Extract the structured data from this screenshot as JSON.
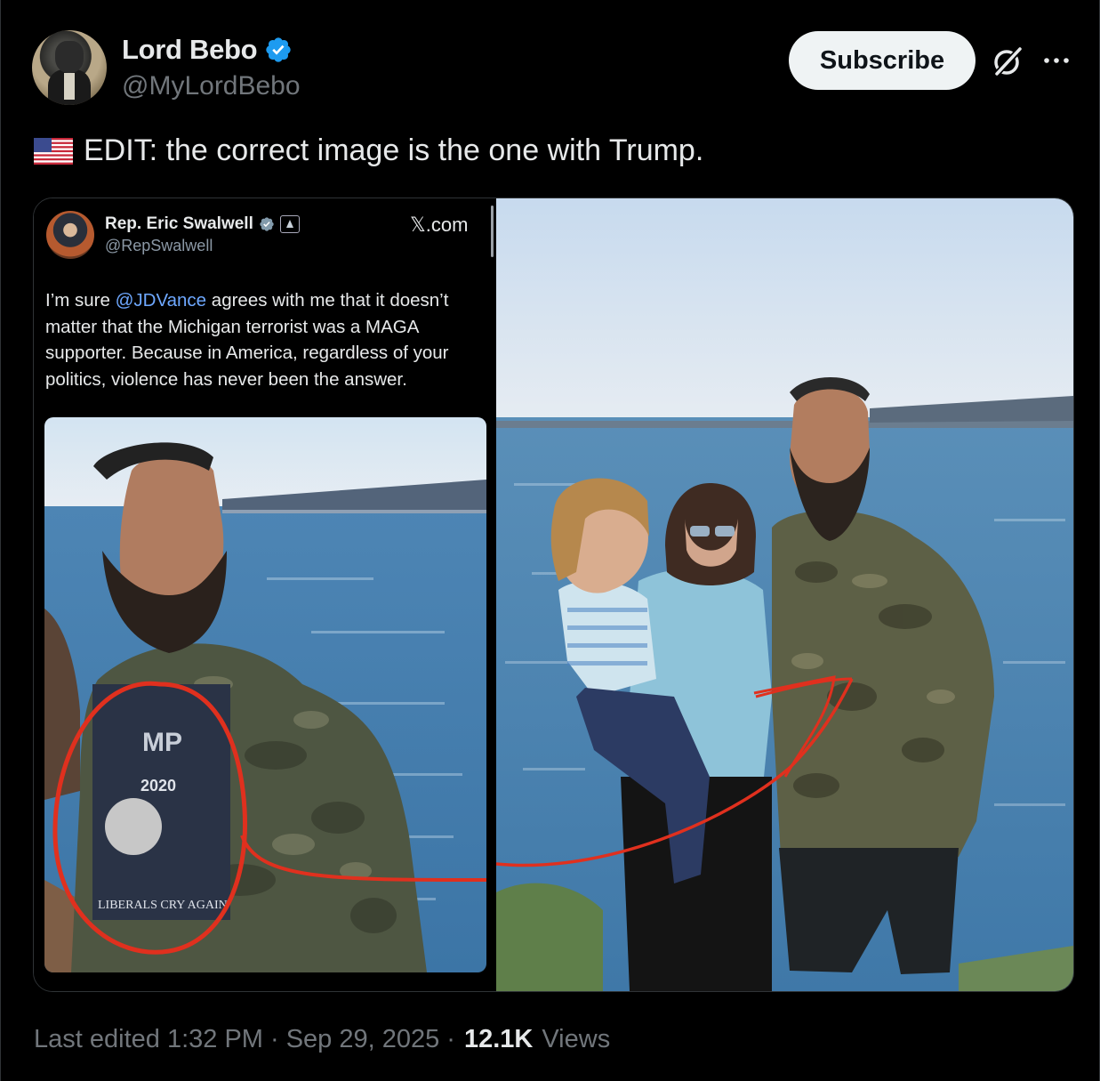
{
  "author": {
    "display_name": "Lord Bebo",
    "handle": "@MyLordBebo",
    "verified": true
  },
  "actions": {
    "subscribe_label": "Subscribe"
  },
  "tweet": {
    "flag_icon": "us-flag-icon",
    "text": "EDIT: the correct image is the one with Trump."
  },
  "embedded_post": {
    "name": "Rep. Eric Swalwell",
    "handle": "@RepSwalwell",
    "site": "𝕏.com",
    "text_before_mention": "I’m sure ",
    "mention": "@JDVance",
    "text_after_mention": " agrees with me that it doesn’t matter that the Michigan terrorist was a MAGA supporter.  Because in America, regardless of your politics, violence has never been the answer.",
    "shirt_print_number": "2020",
    "shirt_print_text": "LIBERALS CRY AGAIN"
  },
  "footer": {
    "edited_label": "Last edited 1:32 PM · Sep 29, 2025 · ",
    "views_count": "12.1K",
    "views_label": "Views"
  },
  "colors": {
    "background": "#000000",
    "text_primary": "#e7e9ea",
    "text_secondary": "#71767b",
    "verified_blue": "#1d9bf0",
    "mention_blue": "#6ea8ff",
    "annotation_red": "#e0301e"
  }
}
